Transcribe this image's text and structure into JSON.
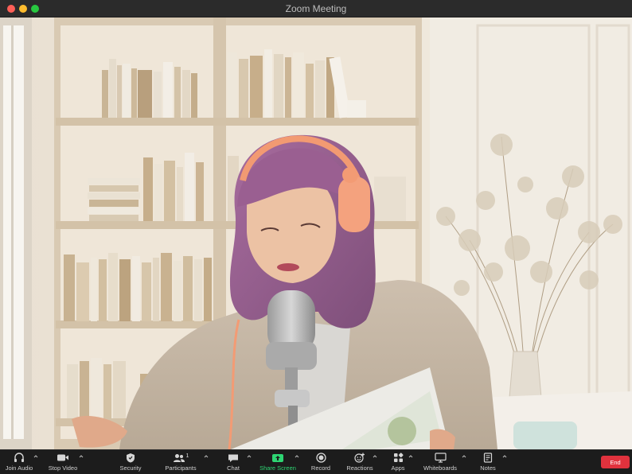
{
  "window": {
    "title": "Zoom Meeting"
  },
  "toolbar": {
    "join_audio": "Join Audio",
    "stop_video": "Stop Video",
    "security": "Security",
    "participants": "Participants",
    "participants_count": "1",
    "chat": "Chat",
    "share_screen": "Share Screen",
    "record": "Record",
    "reactions": "Reactions",
    "apps": "Apps",
    "whiteboards": "Whiteboards",
    "notes": "Notes",
    "end": "End"
  },
  "colors": {
    "share_screen_accent": "#2ed573",
    "end_button": "#e0323d",
    "toolbar_bg": "#1c1c1c",
    "titlebar_bg": "#2b2b2b"
  },
  "icons": {
    "join_audio": "headphones-icon",
    "stop_video": "video-camera-icon",
    "security": "shield-icon",
    "participants": "people-icon",
    "chat": "chat-bubble-icon",
    "share_screen": "share-screen-icon",
    "record": "record-icon",
    "reactions": "emoji-plus-icon",
    "apps": "apps-grid-icon",
    "whiteboards": "whiteboard-icon",
    "notes": "notes-icon"
  }
}
